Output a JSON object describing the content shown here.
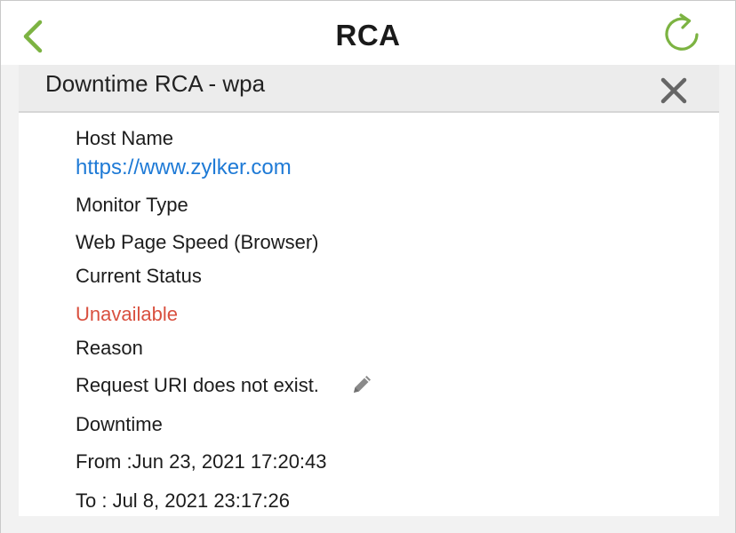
{
  "header": {
    "title": "RCA",
    "back_icon": "chevron-left-icon",
    "refresh_icon": "refresh-icon",
    "accent_color": "#7cb342"
  },
  "panel": {
    "title": "Downtime RCA - wpa",
    "close_icon": "close-icon"
  },
  "details": {
    "host_name_label": "Host Name",
    "host_name_value": "https://www.zylker.com",
    "monitor_type_label": "Monitor Type",
    "monitor_type_value": "Web Page Speed (Browser)",
    "current_status_label": "Current Status",
    "current_status_value": "Unavailable",
    "reason_label": "Reason",
    "reason_value": "Request URI does not exist.",
    "edit_icon": "pencil-icon",
    "downtime_label": "Downtime",
    "from_value": "From :Jun 23, 2021 17:20:43",
    "to_value": "To : Jul 8, 2021 23:17:26"
  },
  "colors": {
    "link": "#1e7ad6",
    "status_unavailable": "#d9503f"
  }
}
